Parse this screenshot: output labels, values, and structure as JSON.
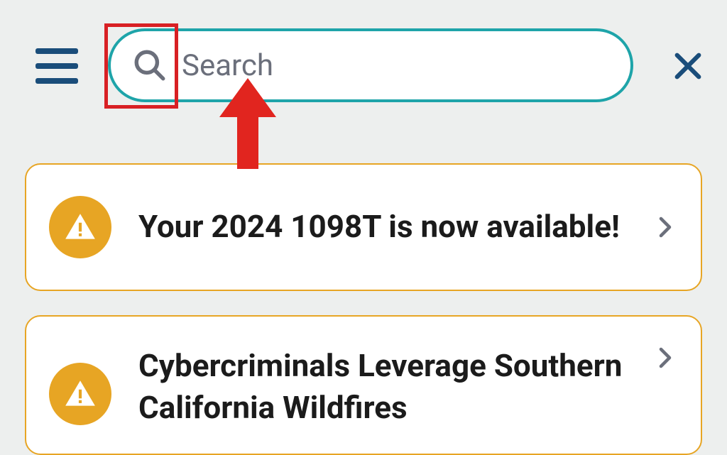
{
  "search": {
    "placeholder": "Search",
    "value": ""
  },
  "alerts": [
    {
      "title": "Your 2024 1098T is now available!"
    },
    {
      "title": "Cybercriminals Leverage Southern California Wildfires"
    }
  ],
  "annotation": {
    "highlight": "search-icon",
    "indicator": "red-arrow"
  }
}
